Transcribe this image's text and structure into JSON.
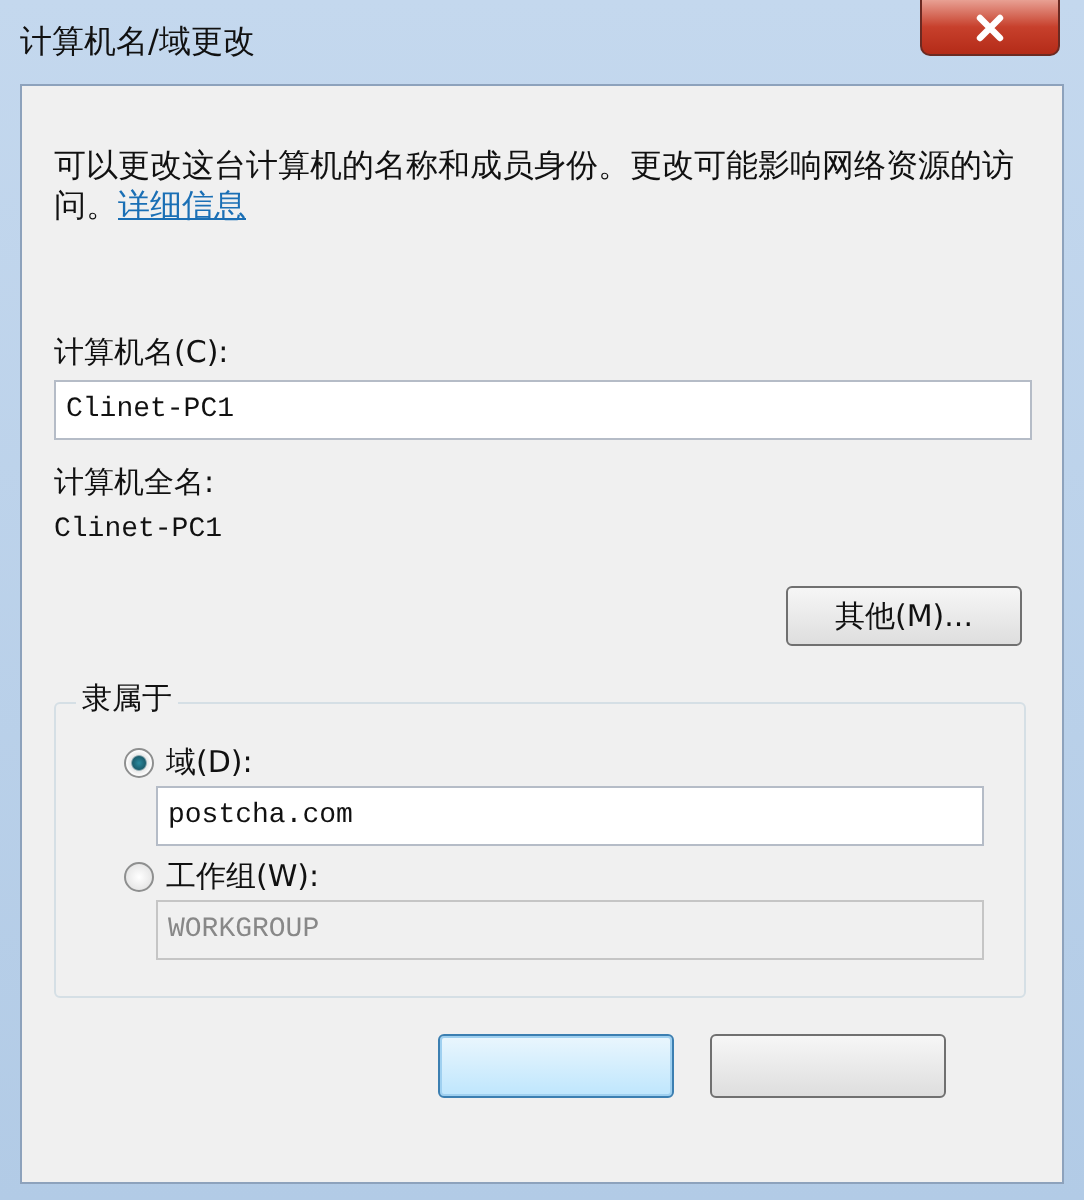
{
  "window": {
    "title": "计算机名/域更改"
  },
  "description": "可以更改这台计算机的名称和成员身份。更改可能影响网络资源的访问。",
  "details_link": "详细信息",
  "computer_name": {
    "label": "计算机名(C):",
    "value": "Clinet-PC1"
  },
  "full_name": {
    "label": "计算机全名:",
    "value": "Clinet-PC1"
  },
  "more_button": "其他(M)...",
  "member_of": {
    "title": "隶属于",
    "options": [
      {
        "label": "域(D):",
        "selected": true,
        "value": "postcha.com"
      },
      {
        "label": "工作组(W):",
        "selected": false,
        "value": "WORKGROUP"
      }
    ]
  }
}
